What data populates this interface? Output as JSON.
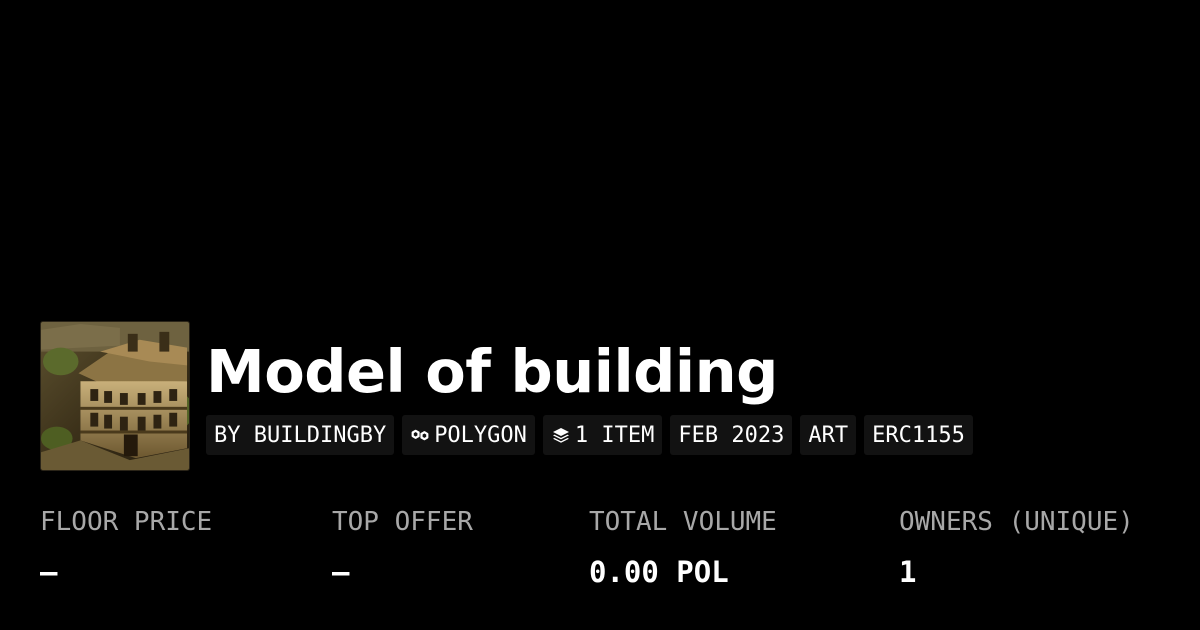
{
  "collection": {
    "title": "Model of building",
    "thumbnail_alt": "Model of building artwork thumbnail"
  },
  "tags": [
    {
      "label": "BY BUILDINGBY",
      "icon": null
    },
    {
      "label": "POLYGON",
      "icon": "polygon-chain-icon"
    },
    {
      "label": "1 ITEM",
      "icon": "layers-icon"
    },
    {
      "label": "FEB 2023",
      "icon": null
    },
    {
      "label": "ART",
      "icon": null
    },
    {
      "label": "ERC1155",
      "icon": null
    }
  ],
  "stats": [
    {
      "label": "FLOOR PRICE",
      "value": "–"
    },
    {
      "label": "TOP OFFER",
      "value": "–"
    },
    {
      "label": "TOTAL VOLUME",
      "value": "0.00 POL"
    },
    {
      "label": "OWNERS (UNIQUE)",
      "value": "1"
    }
  ],
  "colors": {
    "background": "#000000",
    "tag_background": "#121212",
    "label_text": "#a8a8a8",
    "value_text": "#ffffff"
  }
}
